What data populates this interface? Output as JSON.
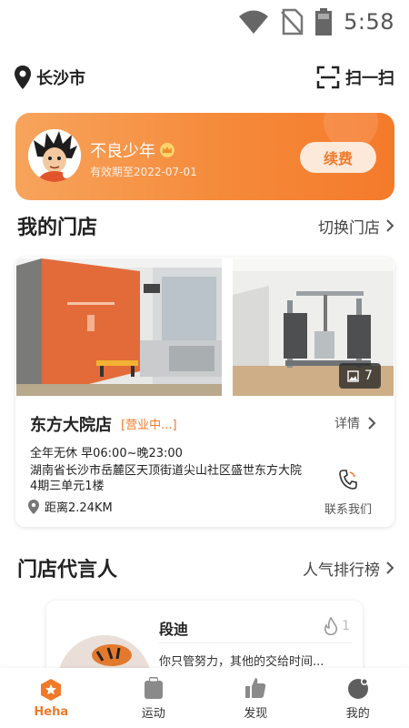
{
  "status_bar": {
    "time": "5:58"
  },
  "location": {
    "city": "长沙市",
    "scan_label": "扫一扫"
  },
  "member": {
    "name": "不良少年",
    "expire": "有效期至2022-07-01",
    "renew_label": "续费"
  },
  "my_store_section": {
    "title": "我的门店",
    "action": "切换门店"
  },
  "store": {
    "photo_count": "7",
    "name": "东方大院店",
    "status": "[营业中...]",
    "detail_label": "详情",
    "hours": "全年无休 早06:00~晚23:00",
    "address": "湖南省长沙市岳麓区天顶街道尖山社区盛世东方大院4期三单元1楼",
    "distance": "距离2.24KM",
    "contact_label": "联系我们"
  },
  "spokesperson_section": {
    "title": "门店代言人",
    "action": "人气排行榜"
  },
  "spokesperson": {
    "name": "段迪",
    "hot_count": "1",
    "quote": "你只管努力，其他的交给时间..."
  },
  "tabs": [
    {
      "label": "Heha",
      "icon": "heha-icon",
      "active": true
    },
    {
      "label": "运动",
      "icon": "sport-icon",
      "active": false
    },
    {
      "label": "发现",
      "icon": "discover-icon",
      "active": false
    },
    {
      "label": "我的",
      "icon": "profile-icon",
      "active": false
    }
  ],
  "colors": {
    "accent": "#f07a2a",
    "card_gradient_start": "#f7a45c",
    "card_gradient_end": "#f57a2b"
  }
}
